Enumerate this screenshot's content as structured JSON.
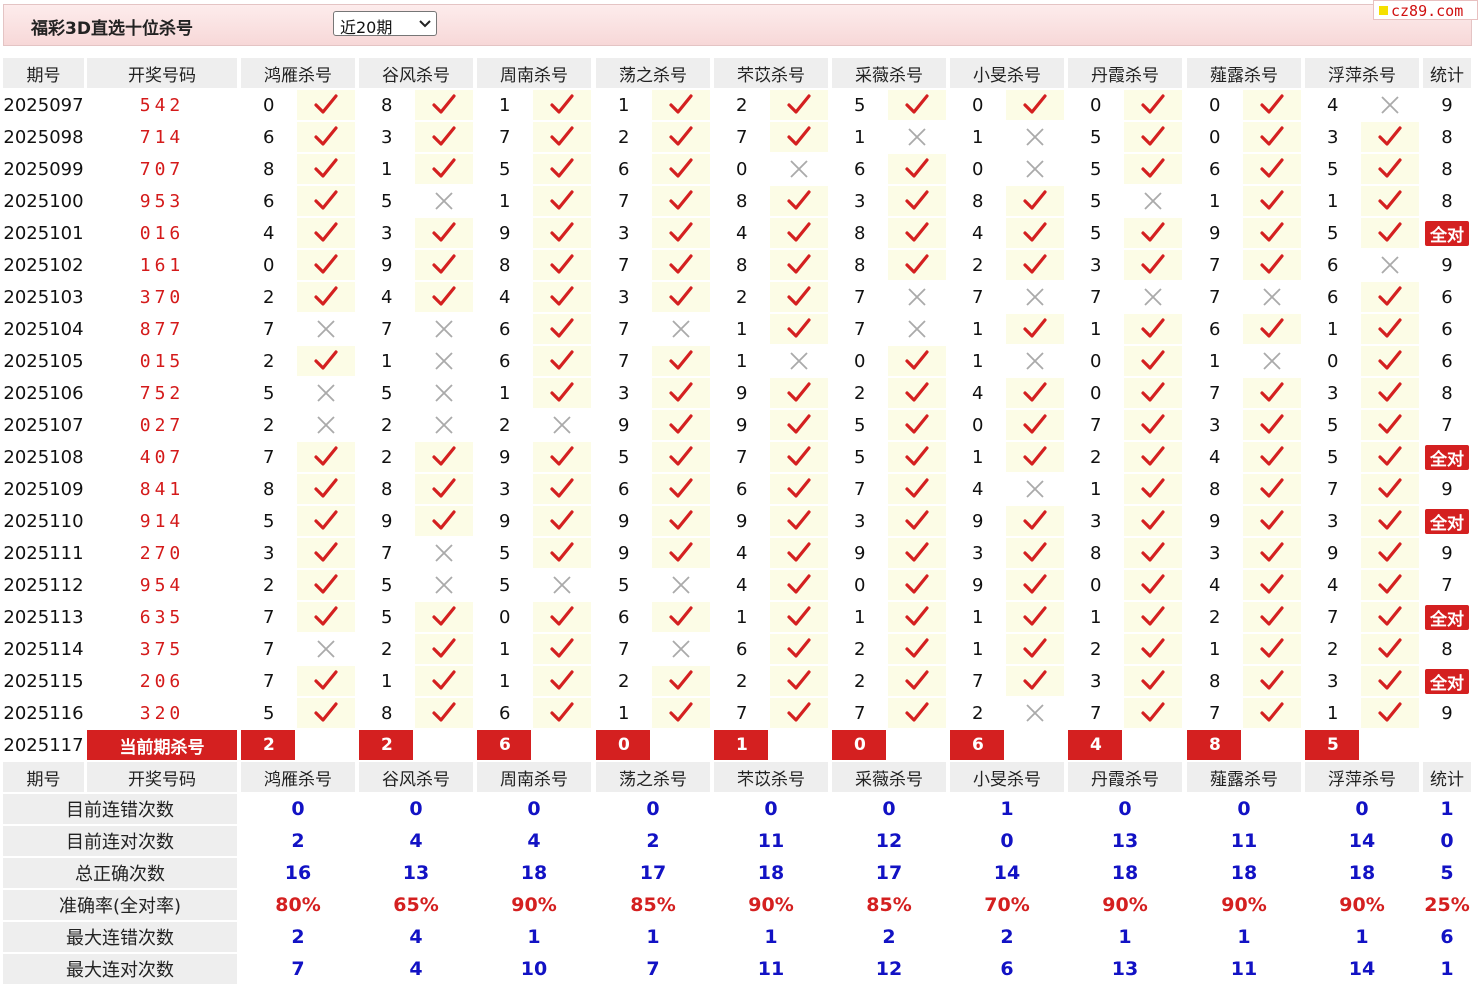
{
  "header": {
    "title": "福彩3D直选十位杀号",
    "period_select": {
      "value": "近20期"
    },
    "site_logo": "cz89.com"
  },
  "columns": {
    "period": "期号",
    "drawn": "开奖号码",
    "experts": [
      "鸿雁杀号",
      "谷风杀号",
      "周南杀号",
      "荡之杀号",
      "芣苡杀号",
      "采薇杀号",
      "小旻杀号",
      "丹霞杀号",
      "薤露杀号",
      "浮萍杀号"
    ],
    "stats": "统计"
  },
  "rows": [
    {
      "period": "2025097",
      "drawn": "542",
      "kills": [
        "0",
        "8",
        "1",
        "1",
        "2",
        "5",
        "0",
        "0",
        "0",
        "4"
      ],
      "results": [
        1,
        1,
        1,
        1,
        1,
        1,
        1,
        1,
        1,
        0
      ],
      "stat": "9"
    },
    {
      "period": "2025098",
      "drawn": "714",
      "kills": [
        "6",
        "3",
        "7",
        "2",
        "7",
        "1",
        "1",
        "5",
        "0",
        "3"
      ],
      "results": [
        1,
        1,
        1,
        1,
        1,
        0,
        0,
        1,
        1,
        1
      ],
      "stat": "8"
    },
    {
      "period": "2025099",
      "drawn": "707",
      "kills": [
        "8",
        "1",
        "5",
        "6",
        "0",
        "6",
        "0",
        "5",
        "6",
        "5"
      ],
      "results": [
        1,
        1,
        1,
        1,
        0,
        1,
        0,
        1,
        1,
        1
      ],
      "stat": "8"
    },
    {
      "period": "2025100",
      "drawn": "953",
      "kills": [
        "6",
        "5",
        "1",
        "7",
        "8",
        "3",
        "8",
        "5",
        "1",
        "1"
      ],
      "results": [
        1,
        0,
        1,
        1,
        1,
        1,
        1,
        0,
        1,
        1
      ],
      "stat": "8"
    },
    {
      "period": "2025101",
      "drawn": "016",
      "kills": [
        "4",
        "3",
        "9",
        "3",
        "4",
        "8",
        "4",
        "5",
        "9",
        "5"
      ],
      "results": [
        1,
        1,
        1,
        1,
        1,
        1,
        1,
        1,
        1,
        1
      ],
      "stat": "全对"
    },
    {
      "period": "2025102",
      "drawn": "161",
      "kills": [
        "0",
        "9",
        "8",
        "7",
        "8",
        "8",
        "2",
        "3",
        "7",
        "6"
      ],
      "results": [
        1,
        1,
        1,
        1,
        1,
        1,
        1,
        1,
        1,
        0
      ],
      "stat": "9"
    },
    {
      "period": "2025103",
      "drawn": "370",
      "kills": [
        "2",
        "4",
        "4",
        "3",
        "2",
        "7",
        "7",
        "7",
        "7",
        "6"
      ],
      "results": [
        1,
        1,
        1,
        1,
        1,
        0,
        0,
        0,
        0,
        1
      ],
      "stat": "6"
    },
    {
      "period": "2025104",
      "drawn": "877",
      "kills": [
        "7",
        "7",
        "6",
        "7",
        "1",
        "7",
        "1",
        "1",
        "6",
        "1"
      ],
      "results": [
        0,
        0,
        1,
        0,
        1,
        0,
        1,
        1,
        1,
        1
      ],
      "stat": "6"
    },
    {
      "period": "2025105",
      "drawn": "015",
      "kills": [
        "2",
        "1",
        "6",
        "7",
        "1",
        "0",
        "1",
        "0",
        "1",
        "0"
      ],
      "results": [
        1,
        0,
        1,
        1,
        0,
        1,
        0,
        1,
        0,
        1
      ],
      "stat": "6"
    },
    {
      "period": "2025106",
      "drawn": "752",
      "kills": [
        "5",
        "5",
        "1",
        "3",
        "9",
        "2",
        "4",
        "0",
        "7",
        "3"
      ],
      "results": [
        0,
        0,
        1,
        1,
        1,
        1,
        1,
        1,
        1,
        1
      ],
      "stat": "8"
    },
    {
      "period": "2025107",
      "drawn": "027",
      "kills": [
        "2",
        "2",
        "2",
        "9",
        "9",
        "5",
        "0",
        "7",
        "3",
        "5"
      ],
      "results": [
        0,
        0,
        0,
        1,
        1,
        1,
        1,
        1,
        1,
        1
      ],
      "stat": "7"
    },
    {
      "period": "2025108",
      "drawn": "407",
      "kills": [
        "7",
        "2",
        "9",
        "5",
        "7",
        "5",
        "1",
        "2",
        "4",
        "5"
      ],
      "results": [
        1,
        1,
        1,
        1,
        1,
        1,
        1,
        1,
        1,
        1
      ],
      "stat": "全对"
    },
    {
      "period": "2025109",
      "drawn": "841",
      "kills": [
        "8",
        "8",
        "3",
        "6",
        "6",
        "7",
        "4",
        "1",
        "8",
        "7"
      ],
      "results": [
        1,
        1,
        1,
        1,
        1,
        1,
        0,
        1,
        1,
        1
      ],
      "stat": "9"
    },
    {
      "period": "2025110",
      "drawn": "914",
      "kills": [
        "5",
        "9",
        "9",
        "9",
        "9",
        "3",
        "9",
        "3",
        "9",
        "3"
      ],
      "results": [
        1,
        1,
        1,
        1,
        1,
        1,
        1,
        1,
        1,
        1
      ],
      "stat": "全对"
    },
    {
      "period": "2025111",
      "drawn": "270",
      "kills": [
        "3",
        "7",
        "5",
        "9",
        "4",
        "9",
        "3",
        "8",
        "3",
        "9"
      ],
      "results": [
        1,
        0,
        1,
        1,
        1,
        1,
        1,
        1,
        1,
        1
      ],
      "stat": "9"
    },
    {
      "period": "2025112",
      "drawn": "954",
      "kills": [
        "2",
        "5",
        "5",
        "5",
        "4",
        "0",
        "9",
        "0",
        "4",
        "4"
      ],
      "results": [
        1,
        0,
        0,
        0,
        1,
        1,
        1,
        1,
        1,
        1
      ],
      "stat": "7"
    },
    {
      "period": "2025113",
      "drawn": "635",
      "kills": [
        "7",
        "5",
        "0",
        "6",
        "1",
        "1",
        "1",
        "1",
        "2",
        "7"
      ],
      "results": [
        1,
        1,
        1,
        1,
        1,
        1,
        1,
        1,
        1,
        1
      ],
      "stat": "全对"
    },
    {
      "period": "2025114",
      "drawn": "375",
      "kills": [
        "7",
        "2",
        "1",
        "7",
        "6",
        "2",
        "1",
        "2",
        "1",
        "2"
      ],
      "results": [
        0,
        1,
        1,
        0,
        1,
        1,
        1,
        1,
        1,
        1
      ],
      "stat": "8"
    },
    {
      "period": "2025115",
      "drawn": "206",
      "kills": [
        "7",
        "1",
        "1",
        "2",
        "2",
        "2",
        "7",
        "3",
        "8",
        "3"
      ],
      "results": [
        1,
        1,
        1,
        1,
        1,
        1,
        1,
        1,
        1,
        1
      ],
      "stat": "全对"
    },
    {
      "period": "2025116",
      "drawn": "320",
      "kills": [
        "5",
        "8",
        "6",
        "1",
        "7",
        "7",
        "2",
        "7",
        "7",
        "1"
      ],
      "results": [
        1,
        1,
        1,
        1,
        1,
        1,
        0,
        1,
        1,
        1
      ],
      "stat": "9"
    }
  ],
  "current": {
    "period": "2025117",
    "label": "当前期杀号",
    "kills": [
      "2",
      "2",
      "6",
      "0",
      "1",
      "0",
      "6",
      "4",
      "8",
      "5"
    ]
  },
  "summary": [
    {
      "label": "目前连错次数",
      "values": [
        "0",
        "0",
        "0",
        "0",
        "0",
        "0",
        "1",
        "0",
        "0",
        "0"
      ],
      "stat": "1",
      "red": false
    },
    {
      "label": "目前连对次数",
      "values": [
        "2",
        "4",
        "4",
        "2",
        "11",
        "12",
        "0",
        "13",
        "11",
        "14"
      ],
      "stat": "0",
      "red": false
    },
    {
      "label": "总正确次数",
      "values": [
        "16",
        "13",
        "18",
        "17",
        "18",
        "17",
        "14",
        "18",
        "18",
        "18"
      ],
      "stat": "5",
      "red": false
    },
    {
      "label": "准确率(全对率)",
      "values": [
        "80%",
        "65%",
        "90%",
        "85%",
        "90%",
        "85%",
        "70%",
        "90%",
        "90%",
        "90%"
      ],
      "stat": "25%",
      "red": true
    },
    {
      "label": "最大连错次数",
      "values": [
        "2",
        "4",
        "1",
        "1",
        "1",
        "2",
        "2",
        "1",
        "1",
        "1"
      ],
      "stat": "6",
      "red": false
    },
    {
      "label": "最大连对次数",
      "values": [
        "7",
        "4",
        "10",
        "7",
        "11",
        "12",
        "6",
        "13",
        "11",
        "14"
      ],
      "stat": "1",
      "red": false
    }
  ],
  "colors": {
    "accent_red": "#d42020",
    "blue": "#1212c4",
    "highlight": "#fcfce6",
    "header_gray": "#eeeeee"
  },
  "icons": {
    "correct": "check-icon",
    "wrong": "cross-icon",
    "dropdown": "chevron-down-icon"
  }
}
